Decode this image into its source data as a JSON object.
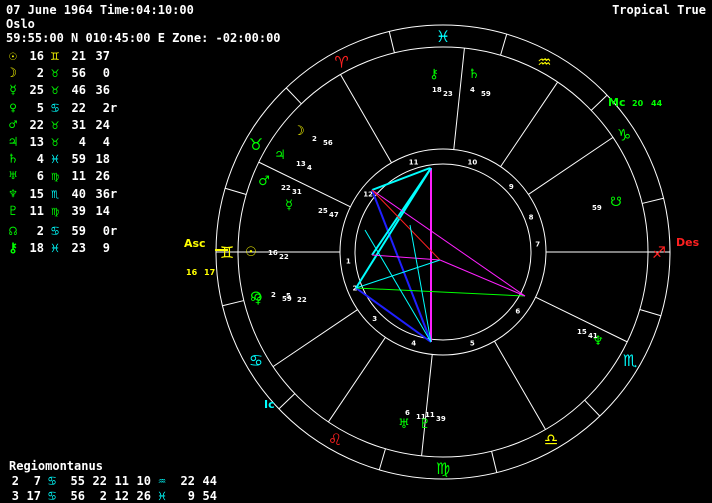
{
  "header": {
    "line1": "07 June 1964 Time:04:10:00",
    "line2": "Oslo",
    "line3": "59:55:00 N 010:45:00 E Zone: -02:00:00",
    "zodiac_label": "Tropical True"
  },
  "colors": {
    "fire": "#ff2020",
    "earth": "#ffff00",
    "air": "#00ff00",
    "water": "#00ffff",
    "white": "#ffffff",
    "magenta": "#ff20ff",
    "blue": "#2020ff"
  },
  "planets": [
    {
      "name": "sun",
      "glyph": "☉",
      "color": "#ffff00",
      "deg": "16",
      "sign": "♊",
      "sign_color": "#ffff00",
      "min": "21",
      "sec": "37",
      "rx": ""
    },
    {
      "name": "moon",
      "glyph": "☽",
      "color": "#ffff00",
      "deg": "2",
      "sign": "♉",
      "sign_color": "#00ff00",
      "min": "56",
      "sec": "0",
      "rx": ""
    },
    {
      "name": "mercury",
      "glyph": "☿",
      "color": "#00ff00",
      "deg": "25",
      "sign": "♉",
      "sign_color": "#00ff00",
      "min": "46",
      "sec": "36",
      "rx": ""
    },
    {
      "name": "venus",
      "glyph": "♀",
      "color": "#00ff00",
      "deg": "5",
      "sign": "♋",
      "sign_color": "#00ffff",
      "min": "22",
      "sec": "2",
      "rx": "r"
    },
    {
      "name": "mars",
      "glyph": "♂",
      "color": "#00ff00",
      "deg": "22",
      "sign": "♉",
      "sign_color": "#00ff00",
      "min": "31",
      "sec": "24",
      "rx": ""
    },
    {
      "name": "jupiter",
      "glyph": "♃",
      "color": "#00ff00",
      "deg": "13",
      "sign": "♉",
      "sign_color": "#00ff00",
      "min": "4",
      "sec": "4",
      "rx": ""
    },
    {
      "name": "saturn",
      "glyph": "♄",
      "color": "#00ff00",
      "deg": "4",
      "sign": "♓",
      "sign_color": "#00ffff",
      "min": "59",
      "sec": "18",
      "rx": ""
    },
    {
      "name": "uranus",
      "glyph": "♅",
      "color": "#00ff00",
      "deg": "6",
      "sign": "♍",
      "sign_color": "#00ff00",
      "min": "11",
      "sec": "26",
      "rx": ""
    },
    {
      "name": "neptune",
      "glyph": "♆",
      "color": "#00ff00",
      "deg": "15",
      "sign": "♏",
      "sign_color": "#00ffff",
      "min": "40",
      "sec": "36",
      "rx": "r"
    },
    {
      "name": "pluto",
      "glyph": "♇",
      "color": "#00ff00",
      "deg": "11",
      "sign": "♍",
      "sign_color": "#00ff00",
      "min": "39",
      "sec": "14",
      "rx": ""
    },
    {
      "name": "node",
      "glyph": "☊",
      "color": "#00ff00",
      "deg": "2",
      "sign": "♋",
      "sign_color": "#00ffff",
      "min": "59",
      "sec": "0",
      "rx": "r"
    },
    {
      "name": "chiron",
      "glyph": "⚷",
      "color": "#00ff00",
      "deg": "18",
      "sign": "♓",
      "sign_color": "#00ffff",
      "min": "23",
      "sec": "9",
      "rx": ""
    }
  ],
  "houses_title": "Regiomontanus",
  "houses_rows": [
    [
      "2",
      "7",
      "♋",
      "55",
      "22",
      "11",
      "10",
      "♒",
      "22",
      "44"
    ],
    [
      "3",
      "17",
      "♋",
      "56",
      "2",
      "12",
      "26",
      "♓",
      "9",
      "54"
    ]
  ],
  "wheel_labels": {
    "asc": "Asc",
    "asc_deg": "16",
    "asc_min": "17",
    "des": "Des",
    "mc": "Mc",
    "mc_deg": "20",
    "mc_min": "44",
    "ic": "Ic"
  },
  "wheel_planets": {
    "moon": {
      "d": "2",
      "m": "56"
    },
    "jupiter": {
      "d": "13",
      "m": "4"
    },
    "mars": {
      "d": "22",
      "m": "31"
    },
    "mercury": {
      "d": "25",
      "m": "47"
    },
    "sun": {
      "d": "16",
      "m": "22"
    },
    "venus": {
      "d": "5",
      "m": "22"
    },
    "node_mean": {
      "d": "2",
      "m": "59"
    },
    "neptune": {
      "d": "15",
      "m": "41"
    },
    "node_true": {
      "d": "59",
      "m": ""
    },
    "uranus": {
      "d": "6",
      "m": "11"
    },
    "pluto": {
      "d": "11",
      "m": "39"
    },
    "chiron": {
      "d": "18",
      "m": "23"
    },
    "saturn": {
      "d": "4",
      "m": "59"
    }
  },
  "house_numbers": [
    "1",
    "2",
    "3",
    "4",
    "5",
    "6",
    "7",
    "8",
    "9",
    "10",
    "11",
    "12"
  ]
}
